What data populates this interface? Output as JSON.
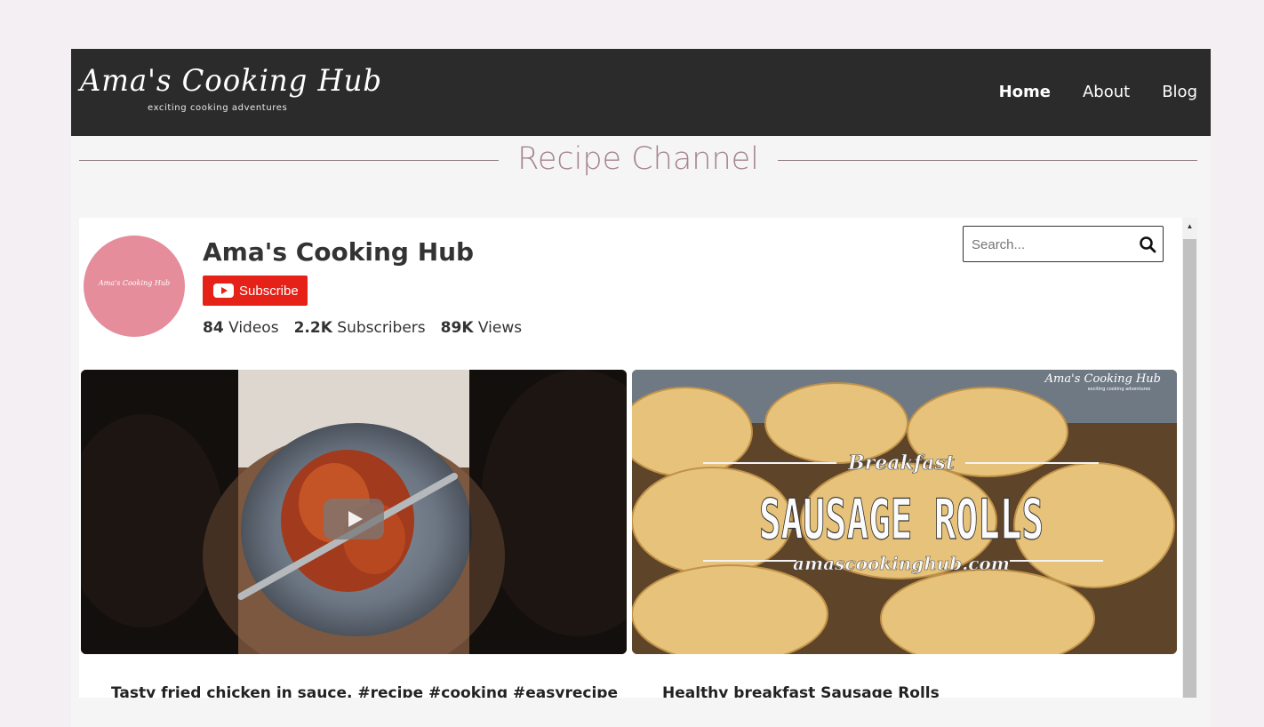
{
  "header": {
    "logo_script": "Ama's Cooking Hub",
    "logo_tagline": "exciting cooking adventures",
    "nav": [
      {
        "label": "Home",
        "active": true
      },
      {
        "label": "About",
        "active": false
      },
      {
        "label": "Blog",
        "active": false
      }
    ]
  },
  "section": {
    "title": "Recipe Channel"
  },
  "channel": {
    "avatar_text": "Ama's Cooking Hub",
    "name": "Ama's Cooking Hub",
    "subscribe_label": "Subscribe",
    "stats": {
      "videos_count": "84",
      "videos_label": "Videos",
      "subscribers_count": "2.2K",
      "subscribers_label": "Subscribers",
      "views_count": "89K",
      "views_label": "Views"
    },
    "search": {
      "placeholder": "Search...",
      "value": ""
    }
  },
  "videos": [
    {
      "title": "Tasty fried chicken in sauce. #recipe #cooking #easyrecipe",
      "thumbnail_icon": "play-icon"
    },
    {
      "title": "Healthy breakfast Sausage Rolls",
      "overlay_top": "Breakfast",
      "overlay_main": "SAUSAGE ROLLS",
      "overlay_url": "amascookinghub.com",
      "watermark": "Ama's Cooking Hub",
      "watermark_tagline": "exciting cooking adventures"
    }
  ],
  "colors": {
    "header_bg": "#2b2b2b",
    "section_title": "#a5848f",
    "subscribe_bg": "#e62117",
    "avatar_bg": "#e58d9b",
    "page_bg": "#f4eff2"
  }
}
